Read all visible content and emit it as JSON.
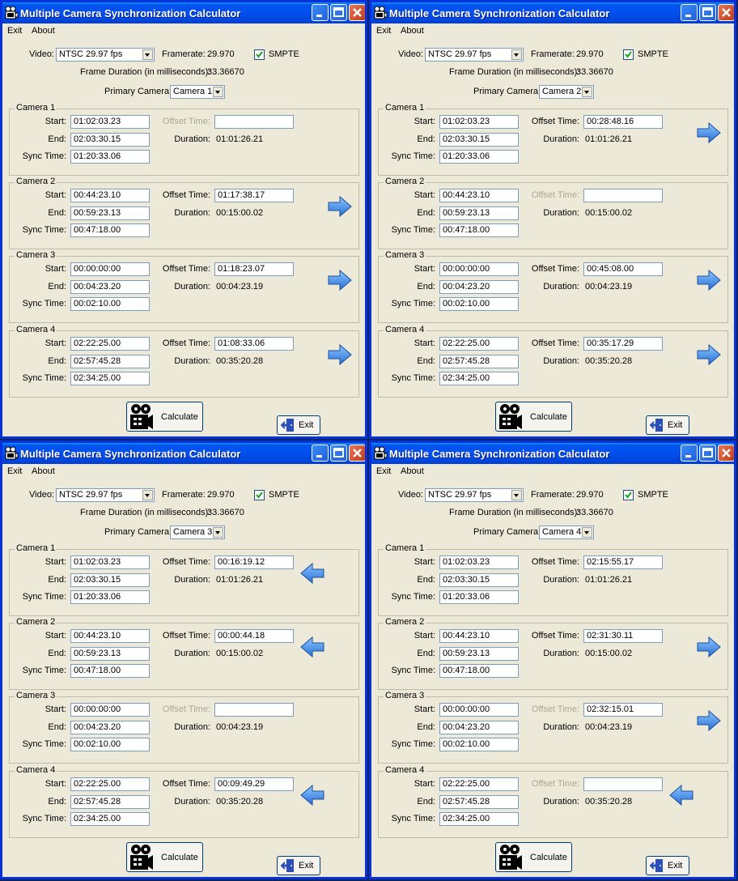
{
  "windows": [
    {
      "title": "Multiple Camera Synchronization Calculator",
      "menu": [
        "Exit",
        "About"
      ],
      "video_label": "Video:",
      "video_value": "NTSC 29.97 fps",
      "framerate_label": "Framerate:",
      "framerate_value": "29.970",
      "smpte_label": "SMPTE",
      "frame_duration_label": "Frame Duration (in milliseconds):",
      "frame_duration_value": "33.36670",
      "primary_label": "Primary Camera",
      "primary_value": "Camera 1",
      "cameras": [
        {
          "name": "Camera 1",
          "start": "01:02:03.23",
          "end": "02:03:30.15",
          "sync": "01:20:33.06",
          "offset": "",
          "duration": "01:01:26.21",
          "offset_enabled": false,
          "arrow": "none"
        },
        {
          "name": "Camera 2",
          "start": "00:44:23.10",
          "end": "00:59:23.13",
          "sync": "00:47:18.00",
          "offset": "01:17:38.17",
          "duration": "00:15:00.02",
          "offset_enabled": true,
          "arrow": "right"
        },
        {
          "name": "Camera 3",
          "start": "00:00:00:00",
          "end": "00:04:23.20",
          "sync": "00:02:10.00",
          "offset": "01:18:23.07",
          "duration": "00:04:23.19",
          "offset_enabled": true,
          "arrow": "right"
        },
        {
          "name": "Camera 4",
          "start": "02:22:25.00",
          "end": "02:57:45.28",
          "sync": "02:34:25.00",
          "offset": "01:08:33.06",
          "duration": "00:35:20.28",
          "offset_enabled": true,
          "arrow": "right"
        }
      ],
      "calculate_label": "Calculate",
      "exit_label": "Exit"
    },
    {
      "title": "Multiple Camera Synchronization Calculator",
      "menu": [
        "Exit",
        "About"
      ],
      "video_label": "Video:",
      "video_value": "NTSC 29.97 fps",
      "framerate_label": "Framerate:",
      "framerate_value": "29.970",
      "smpte_label": "SMPTE",
      "frame_duration_label": "Frame Duration (in milliseconds):",
      "frame_duration_value": "33.36670",
      "primary_label": "Primary Camera",
      "primary_value": "Camera 2",
      "cameras": [
        {
          "name": "Camera 1",
          "start": "01:02:03.23",
          "end": "02:03:30.15",
          "sync": "01:20:33.06",
          "offset": "00:28:48.16",
          "duration": "01:01:26.21",
          "offset_enabled": true,
          "arrow": "right"
        },
        {
          "name": "Camera 2",
          "start": "00:44:23.10",
          "end": "00:59:23.13",
          "sync": "00:47:18.00",
          "offset": "",
          "duration": "00:15:00.02",
          "offset_enabled": false,
          "arrow": "none"
        },
        {
          "name": "Camera 3",
          "start": "00:00:00:00",
          "end": "00:04:23.20",
          "sync": "00:02:10.00",
          "offset": "00:45:08.00",
          "duration": "00:04:23.19",
          "offset_enabled": true,
          "arrow": "right"
        },
        {
          "name": "Camera 4",
          "start": "02:22:25.00",
          "end": "02:57:45.28",
          "sync": "02:34:25.00",
          "offset": "00:35:17.29",
          "duration": "00:35:20.28",
          "offset_enabled": true,
          "arrow": "right"
        }
      ],
      "calculate_label": "Calculate",
      "exit_label": "Exit"
    },
    {
      "title": "Multiple Camera Synchronization Calculator",
      "menu": [
        "Exit",
        "About"
      ],
      "video_label": "Video:",
      "video_value": "NTSC 29.97 fps",
      "framerate_label": "Framerate:",
      "framerate_value": "29.970",
      "smpte_label": "SMPTE",
      "frame_duration_label": "Frame Duration (in milliseconds):",
      "frame_duration_value": "33.36670",
      "primary_label": "Primary Camera",
      "primary_value": "Camera 3",
      "cameras": [
        {
          "name": "Camera 1",
          "start": "01:02:03.23",
          "end": "02:03:30.15",
          "sync": "01:20:33.06",
          "offset": "00:16:19.12",
          "duration": "01:01:26.21",
          "offset_enabled": true,
          "arrow": "left"
        },
        {
          "name": "Camera 2",
          "start": "00:44:23.10",
          "end": "00:59:23.13",
          "sync": "00:47:18.00",
          "offset": "00:00:44.18",
          "duration": "00:15:00.02",
          "offset_enabled": true,
          "arrow": "left"
        },
        {
          "name": "Camera 3",
          "start": "00:00:00:00",
          "end": "00:04:23.20",
          "sync": "00:02:10.00",
          "offset": "",
          "duration": "00:04:23.19",
          "offset_enabled": false,
          "arrow": "none"
        },
        {
          "name": "Camera 4",
          "start": "02:22:25.00",
          "end": "02:57:45.28",
          "sync": "02:34:25.00",
          "offset": "00:09:49.29",
          "duration": "00:35:20.28",
          "offset_enabled": true,
          "arrow": "left"
        }
      ],
      "calculate_label": "Calculate",
      "exit_label": "Exit"
    },
    {
      "title": "Multiple Camera Synchronization Calculator",
      "menu": [
        "Exit",
        "About"
      ],
      "video_label": "Video:",
      "video_value": "NTSC 29.97 fps",
      "framerate_label": "Framerate:",
      "framerate_value": "29.970",
      "smpte_label": "SMPTE",
      "frame_duration_label": "Frame Duration (in milliseconds):",
      "frame_duration_value": "33.36670",
      "primary_label": "Primary Camera",
      "primary_value": "Camera 4",
      "cameras": [
        {
          "name": "Camera 1",
          "start": "01:02:03.23",
          "end": "02:03:30.15",
          "sync": "01:20:33.06",
          "offset": "02:15:55.17",
          "duration": "01:01:26.21",
          "offset_enabled": true,
          "arrow": "none"
        },
        {
          "name": "Camera 2",
          "start": "00:44:23.10",
          "end": "00:59:23.13",
          "sync": "00:47:18.00",
          "offset": "02:31:30.11",
          "duration": "00:15:00.02",
          "offset_enabled": true,
          "arrow": "right"
        },
        {
          "name": "Camera 3",
          "start": "00:00:00:00",
          "end": "00:04:23.20",
          "sync": "00:02:10.00",
          "offset": "02:32:15.01",
          "duration": "00:04:23.19",
          "offset_enabled": false,
          "arrow": "right"
        },
        {
          "name": "Camera 4",
          "start": "02:22:25.00",
          "end": "02:57:45.28",
          "sync": "02:34:25.00",
          "offset": "",
          "duration": "00:35:20.28",
          "offset_enabled": false,
          "arrow": "left"
        }
      ],
      "calculate_label": "Calculate",
      "exit_label": "Exit"
    }
  ],
  "labels": {
    "start": "Start:",
    "end": "End:",
    "sync": "Sync Time:",
    "offset": "Offset Time:",
    "duration": "Duration:"
  },
  "icons": {
    "app": "camera-icon",
    "minimize": "minimize-icon",
    "maximize": "maximize-icon",
    "close": "close-icon",
    "arrow_right": "arrow-right-icon",
    "arrow_left": "arrow-left-icon",
    "calculate": "movie-camera-icon",
    "exit": "exit-door-icon"
  },
  "colors": {
    "title_bar": "#0053ee",
    "window_bg": "#ece9d8",
    "close_button": "#d4532e",
    "arrow": "#4a8fe0"
  }
}
